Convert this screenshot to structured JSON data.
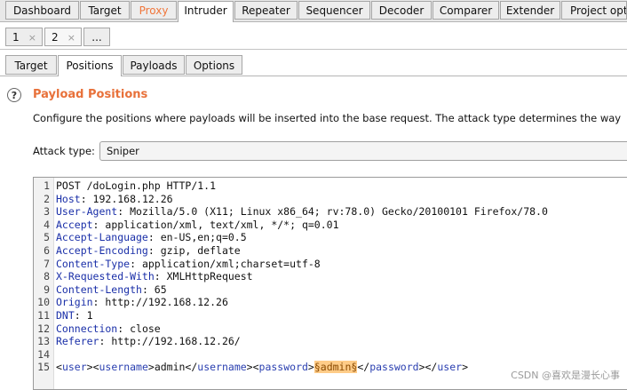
{
  "tool_tabs": [
    "Dashboard",
    "Target",
    "Proxy",
    "Intruder",
    "Repeater",
    "Sequencer",
    "Decoder",
    "Comparer",
    "Extender",
    "Project opt"
  ],
  "request_tabs": [
    "1",
    "2",
    "..."
  ],
  "close_glyph": "×",
  "intruder_tabs": [
    "Target",
    "Positions",
    "Payloads",
    "Options"
  ],
  "section": {
    "help_glyph": "?",
    "title": "Payload Positions",
    "description": "Configure the positions where payloads will be inserted into the base request. The attack type determines the way"
  },
  "attack_type": {
    "label": "Attack type:",
    "value": "Sniper"
  },
  "request_lines": [
    {
      "n": "1",
      "parts": [
        {
          "t": "POST /doLogin.php HTTP/1.1",
          "c": "plain"
        }
      ]
    },
    {
      "n": "2",
      "parts": [
        {
          "t": "Host",
          "c": "hk"
        },
        {
          "t": ": 192.168.12.26",
          "c": "plain"
        }
      ]
    },
    {
      "n": "3",
      "parts": [
        {
          "t": "User-Agent",
          "c": "hk"
        },
        {
          "t": ": Mozilla/5.0 (X11; Linux x86_64; rv:78.0) Gecko/20100101 Firefox/78.0",
          "c": "plain"
        }
      ]
    },
    {
      "n": "4",
      "parts": [
        {
          "t": "Accept",
          "c": "hk"
        },
        {
          "t": ": application/xml, text/xml, */*; q=0.01",
          "c": "plain"
        }
      ]
    },
    {
      "n": "5",
      "parts": [
        {
          "t": "Accept-Language",
          "c": "hk"
        },
        {
          "t": ": en-US,en;q=0.5",
          "c": "plain"
        }
      ]
    },
    {
      "n": "6",
      "parts": [
        {
          "t": "Accept-Encoding",
          "c": "hk"
        },
        {
          "t": ": gzip, deflate",
          "c": "plain"
        }
      ]
    },
    {
      "n": "7",
      "parts": [
        {
          "t": "Content-Type",
          "c": "hk"
        },
        {
          "t": ": application/xml;charset=utf-8",
          "c": "plain"
        }
      ]
    },
    {
      "n": "8",
      "parts": [
        {
          "t": "X-Requested-With",
          "c": "hk"
        },
        {
          "t": ": XMLHttpRequest",
          "c": "plain"
        }
      ]
    },
    {
      "n": "9",
      "parts": [
        {
          "t": "Content-Length",
          "c": "hk"
        },
        {
          "t": ": 65",
          "c": "plain"
        }
      ]
    },
    {
      "n": "10",
      "parts": [
        {
          "t": "Origin",
          "c": "hk"
        },
        {
          "t": ": http://192.168.12.26",
          "c": "plain"
        }
      ]
    },
    {
      "n": "11",
      "parts": [
        {
          "t": "DNT",
          "c": "hk"
        },
        {
          "t": ": 1",
          "c": "plain"
        }
      ]
    },
    {
      "n": "12",
      "parts": [
        {
          "t": "Connection",
          "c": "hk"
        },
        {
          "t": ": close",
          "c": "plain"
        }
      ]
    },
    {
      "n": "13",
      "parts": [
        {
          "t": "Referer",
          "c": "hk"
        },
        {
          "t": ": http://192.168.12.26/",
          "c": "plain"
        }
      ]
    },
    {
      "n": "14",
      "parts": []
    },
    {
      "n": "15",
      "parts": [
        {
          "t": "<",
          "c": "plain"
        },
        {
          "t": "user",
          "c": "tg"
        },
        {
          "t": "><",
          "c": "plain"
        },
        {
          "t": "username",
          "c": "tg"
        },
        {
          "t": ">admin</",
          "c": "plain"
        },
        {
          "t": "username",
          "c": "tg"
        },
        {
          "t": "><",
          "c": "plain"
        },
        {
          "t": "password",
          "c": "tg"
        },
        {
          "t": ">",
          "c": "plain"
        },
        {
          "t": "§admin§",
          "c": "pm"
        },
        {
          "t": "</",
          "c": "plain"
        },
        {
          "t": "password",
          "c": "tg"
        },
        {
          "t": "></",
          "c": "plain"
        },
        {
          "t": "user",
          "c": "tg"
        },
        {
          "t": ">",
          "c": "plain"
        }
      ]
    }
  ],
  "watermark": "CSDN @喜欢是漫长心事",
  "colors": {
    "accent": "#e8713a",
    "header_key": "#1a2fa8",
    "payload_marker_bg": "#ffcc88"
  }
}
